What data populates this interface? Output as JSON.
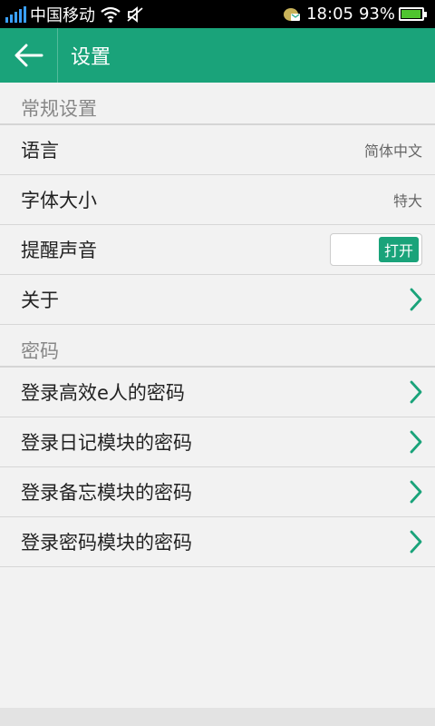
{
  "status": {
    "carrier": "中国移动",
    "time": "18:05",
    "battery": "93%"
  },
  "appbar": {
    "title": "设置"
  },
  "sections": {
    "general": {
      "title": "常规设置",
      "language": {
        "label": "语言",
        "value": "简体中文"
      },
      "font_size": {
        "label": "字体大小",
        "value": "特大"
      },
      "reminder_sound": {
        "label": "提醒声音",
        "toggle": "打开"
      },
      "about": {
        "label": "关于"
      }
    },
    "password": {
      "title": "密码",
      "items": [
        "登录高效e人的密码",
        "登录日记模块的密码",
        "登录备忘模块的密码",
        "登录密码模块的密码"
      ]
    }
  },
  "colors": {
    "accent": "#1aa37a",
    "background": "#f2f2f2"
  }
}
